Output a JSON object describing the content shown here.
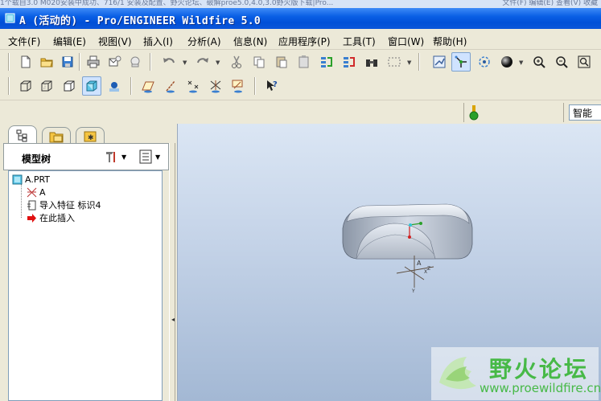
{
  "browser_ghost": {
    "left_text": "1个载自3.0 M020安装中成功、716/1 安装及配置、野火论坛、破解proe5.0,4.0,3.0野火版下载|Pro...",
    "right_text": "文件(F)  编辑(E)  查看(V)  收藏"
  },
  "window": {
    "title": "A (活动的) - Pro/ENGINEER Wildfire 5.0"
  },
  "menu": [
    {
      "label": "文件(F)"
    },
    {
      "label": "编辑(E)"
    },
    {
      "label": "视图(V)"
    },
    {
      "label": "插入(I)"
    },
    {
      "label": "分析(A)"
    },
    {
      "label": "信息(N)"
    },
    {
      "label": "应用程序(P)"
    },
    {
      "label": "工具(T)"
    },
    {
      "label": "窗口(W)"
    },
    {
      "label": "帮助(H)"
    }
  ],
  "status": {
    "filter_value": "智能"
  },
  "navigator": {
    "header_label": "模型树"
  },
  "model_tree": {
    "items": [
      {
        "label": "A.PRT",
        "icon": "part-icon"
      },
      {
        "label": "A",
        "icon": "csys-icon"
      },
      {
        "label": "导入特征 标识4",
        "icon": "import-feature-icon"
      },
      {
        "label": "在此插入",
        "icon": "insert-here-arrow-icon"
      }
    ]
  },
  "graphics": {
    "csys_label": "A",
    "axis_x": "X",
    "axis_y": "Y",
    "axis_z": "Z"
  },
  "watermark": {
    "text": "野火论坛",
    "url": "www.proewildfire.cn"
  },
  "colors": {
    "title_bar": "#0a5fe5",
    "chrome": "#ece9d8",
    "graphics_top": "#dbe6f4",
    "graphics_bottom": "#a3b8d4",
    "watermark_green": "#47b947",
    "insert_arrow": "#e01010"
  }
}
